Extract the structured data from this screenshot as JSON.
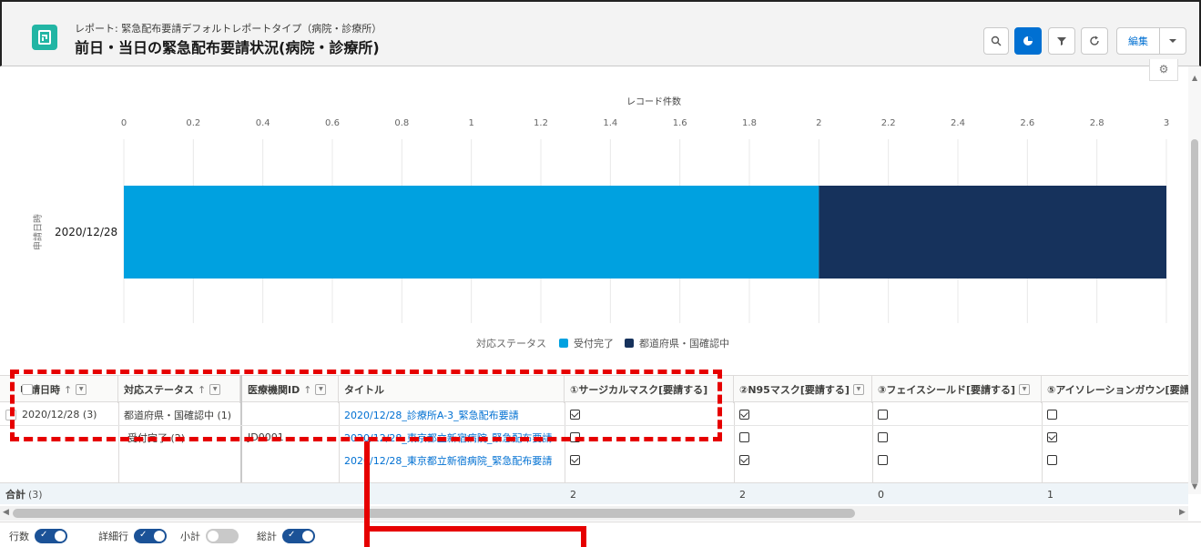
{
  "header": {
    "subtitle": "レポート: 緊急配布要請デフォルトレポートタイプ（病院・診療所）",
    "title": "前日・当日の緊急配布要請状況(病院・診療所)",
    "edit_label": "編集"
  },
  "chart_data": {
    "type": "bar",
    "orientation": "horizontal",
    "stacked": true,
    "xlabel": "レコード件数",
    "ylabel": "申請日時",
    "xlim": [
      0,
      3
    ],
    "xticks": [
      "0",
      "0.2",
      "0.4",
      "0.6",
      "0.8",
      "1",
      "1.2",
      "1.4",
      "1.6",
      "1.8",
      "2",
      "2.2",
      "2.4",
      "2.6",
      "2.8",
      "3"
    ],
    "categories": [
      "2020/12/28"
    ],
    "series": [
      {
        "name": "受付完了",
        "values": [
          2
        ],
        "color": "#00a1e0"
      },
      {
        "name": "都道府県・国確認中",
        "values": [
          1
        ],
        "color": "#16325c"
      }
    ],
    "legend_title": "対応ステータス",
    "legend_position": "bottom",
    "grid": true
  },
  "table": {
    "headers": {
      "date": "申請日時",
      "status": "対応ステータス",
      "facility": "医療機関ID",
      "title": "タイトル",
      "surgical": "①サージカルマスク[要請する]",
      "n95": "②N95マスク[要請する]",
      "face": "③フェイスシールド[要請する]",
      "gown": "⑤アイソレーションガウン[要請"
    },
    "group_date": "2020/12/28 (3)",
    "status_group_1": "都道府県・国確認中 (1)",
    "status_group_2": "受付完了 (2)",
    "facility_id_partial": "JD0001",
    "rows": [
      {
        "title": "2020/12/28_診療所A-3_緊急配布要請",
        "surgical": true,
        "n95": true,
        "face": false,
        "gown": false
      },
      {
        "title": "2020/12/28_東京都立新宿病院_緊急配布要請",
        "surgical": false,
        "n95": false,
        "face": false,
        "gown": true
      },
      {
        "title": "2020/12/28_東京都立新宿病院_緊急配布要請",
        "surgical": true,
        "n95": true,
        "face": false,
        "gown": false
      }
    ],
    "total_label": "合計",
    "total_count": "(3)",
    "totals": {
      "surgical": "2",
      "n95": "2",
      "face": "0",
      "gown": "1"
    }
  },
  "footer": {
    "row_count": "行数",
    "detail_rows": "詳細行",
    "subtotal": "小計",
    "grand_total": "総計"
  },
  "colors": {
    "accent": "#0070d2",
    "annotation": "#e60000",
    "bar_light": "#00a1e0",
    "bar_dark": "#16325c"
  }
}
